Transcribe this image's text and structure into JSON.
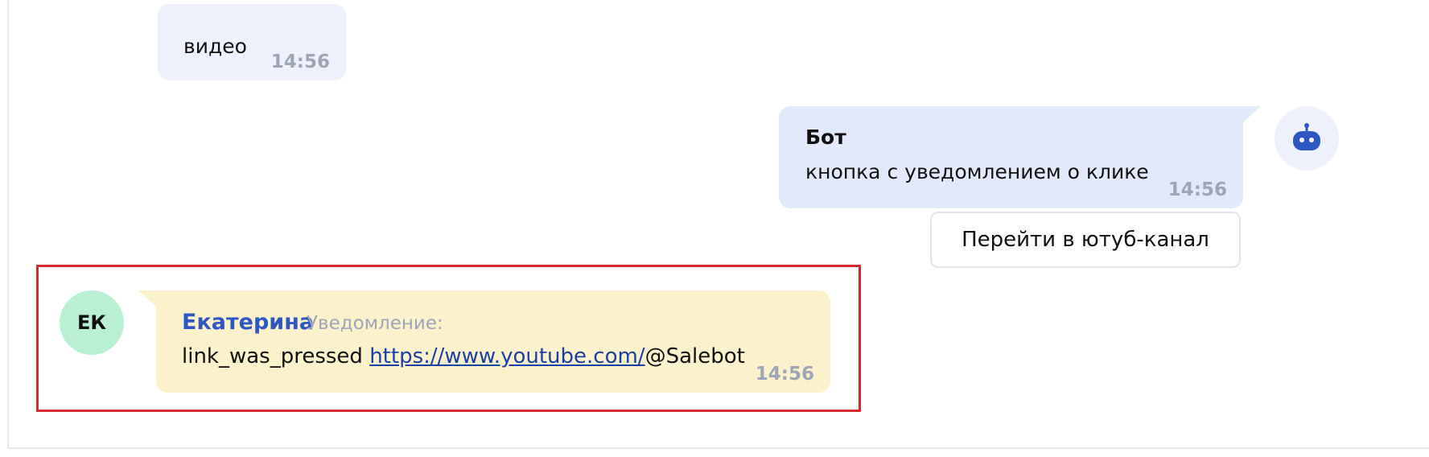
{
  "messages": {
    "video": {
      "text": "видео",
      "time": "14:56"
    },
    "bot": {
      "sender": "Бот",
      "text": "кнопка с уведомлением о клике",
      "time": "14:56",
      "button_label": "Перейти в ютуб-канал",
      "avatar_icon": "robot-icon"
    },
    "user": {
      "avatar_initials": "ЕК",
      "sender": "Екатерина",
      "notice_label": "Уведомление:",
      "text_prefix": "link_was_pressed ",
      "link": "https://www.youtube.com/",
      "text_suffix": "@Salebot",
      "time": "14:56"
    }
  },
  "colors": {
    "bot_bubble": "#e1e9fb",
    "user_bubble": "#fbf1ca",
    "user_avatar": "#b9f0d3",
    "highlight_border": "#d12b2b",
    "sender_name": "#2e57c4",
    "bot_icon": "#2e57c4"
  }
}
